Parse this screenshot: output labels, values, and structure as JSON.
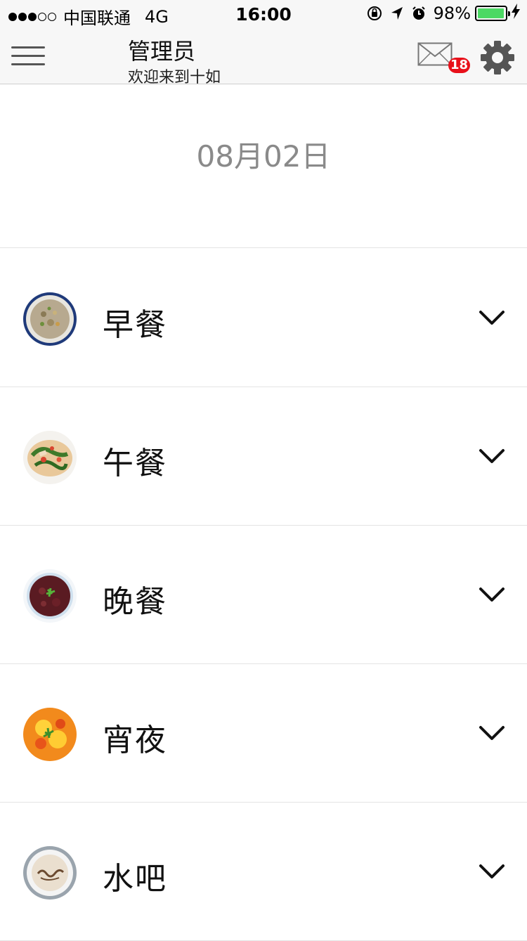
{
  "status_bar": {
    "signal_dots_filled": 3,
    "signal_dots_total": 5,
    "carrier": "中国联通",
    "network": "4G",
    "time": "16:00",
    "battery_percent": "98%",
    "battery_level": 0.98,
    "icons": [
      "orientation-lock-icon",
      "location-arrow-icon",
      "alarm-icon",
      "charging-bolt-icon"
    ]
  },
  "nav": {
    "title": "管理员",
    "subtitle": "欢迎来到十如",
    "menu_icon": "hamburger-menu-icon",
    "mail_icon": "mail-envelope-icon",
    "mail_badge": "18",
    "settings_icon": "gear-icon"
  },
  "date": "08月02日",
  "meals": [
    {
      "label": "早餐",
      "thumb": "porridge-bowl"
    },
    {
      "label": "午餐",
      "thumb": "stir-fry-plate"
    },
    {
      "label": "晚餐",
      "thumb": "braised-meat-bowl"
    },
    {
      "label": "宵夜",
      "thumb": "tomato-egg-dish"
    },
    {
      "label": "水吧",
      "thumb": "coffee-cup"
    }
  ],
  "colors": {
    "bar_background": "#f7f7f7",
    "badge_red": "#e8101a",
    "battery_green": "#4cd964",
    "date_gray": "#8a8a8a"
  }
}
